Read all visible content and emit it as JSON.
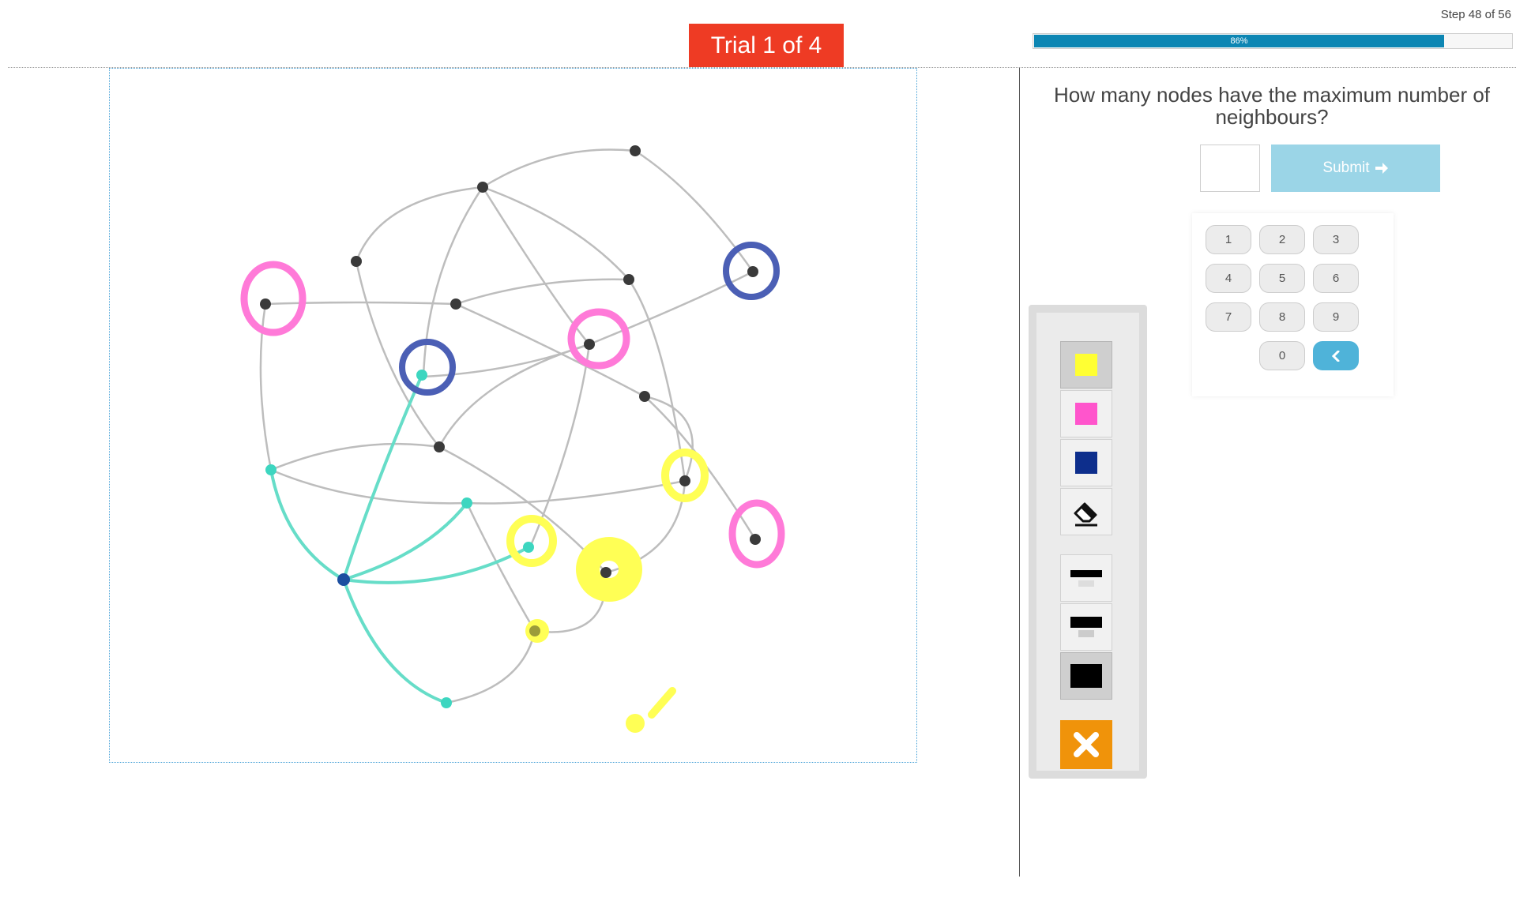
{
  "header": {
    "step_label": "Step 48 of 56",
    "trial_label": "Trial 1 of 4",
    "progress_label": "86%",
    "progress_fraction": 0.86,
    "trial_color": "#ee3b24",
    "progress_color": "#0d86b3"
  },
  "question": {
    "text": "How many nodes have the maximum number of neighbours?",
    "answer_value": "",
    "submit_label": "Submit",
    "submit_icon": "arrow-right-icon",
    "submit_color": "#9bd5e7"
  },
  "keypad": {
    "keys": [
      "1",
      "2",
      "3",
      "4",
      "5",
      "6",
      "7",
      "8",
      "9",
      "0"
    ],
    "backspace_icon": "chevron-left-icon",
    "backspace_color": "#4fb3d9"
  },
  "toolbar": {
    "colors": [
      {
        "name": "yellow",
        "hex": "#ffff33",
        "selected": true
      },
      {
        "name": "pink",
        "hex": "#ff55cc",
        "selected": false
      },
      {
        "name": "blue",
        "hex": "#0d2e8c",
        "selected": false
      }
    ],
    "eraser_icon": "eraser-icon",
    "brush_sizes": [
      "thin",
      "medium",
      "thick"
    ],
    "selected_brush_size": "thick",
    "close_icon": "close-icon",
    "close_color": "#f0930a"
  },
  "graph": {
    "edge_color": "#bdbdbd",
    "highlight_edge_color": "#66ddc8",
    "node_color": "#3a3a3a",
    "highlight_node_color": "#3dd6c0",
    "annotation_colors": {
      "pink": "#ff7ad8",
      "blue": "#4b5fb5",
      "yellow": "#ffff55"
    }
  }
}
